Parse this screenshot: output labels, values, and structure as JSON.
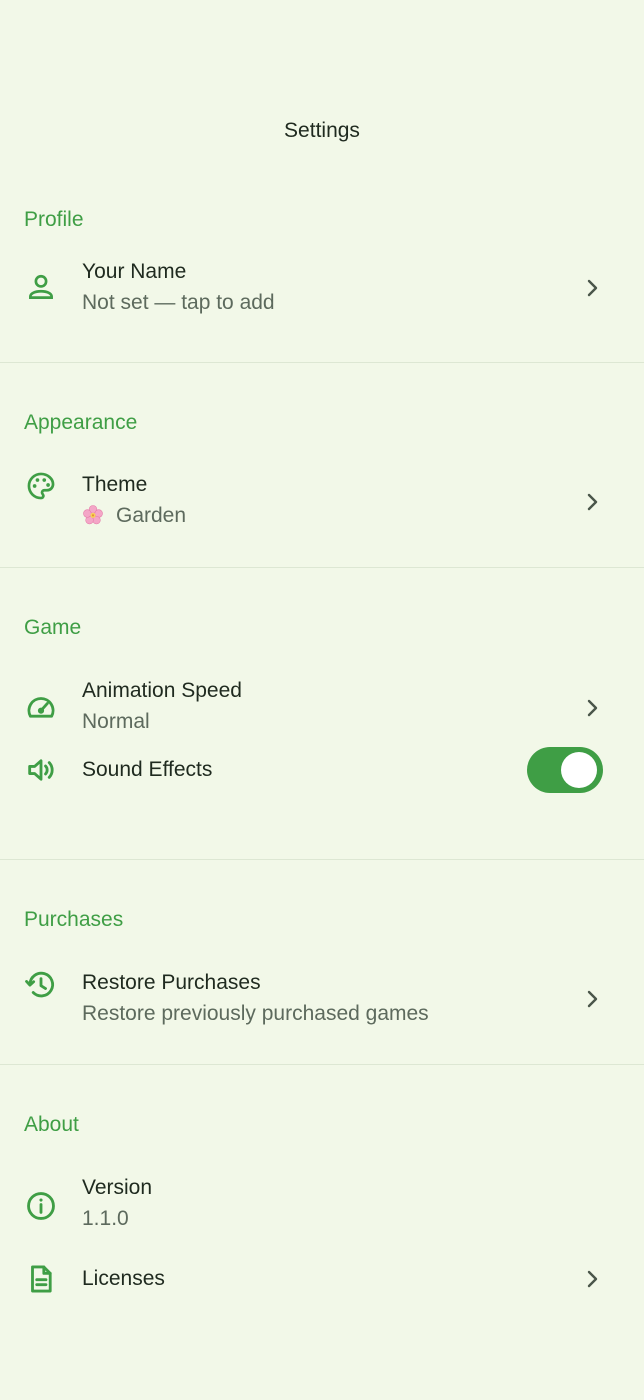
{
  "app_bar": {
    "title": "Settings"
  },
  "sections": {
    "profile": {
      "header": "Profile",
      "your_name": {
        "label": "Your Name",
        "value": "Not set — tap to add",
        "icon": "person-icon"
      }
    },
    "appearance": {
      "header": "Appearance",
      "theme": {
        "label": "Theme",
        "value": "Garden",
        "emoji": "cherry-blossom",
        "icon": "palette-icon"
      }
    },
    "game": {
      "header": "Game",
      "animation_speed": {
        "label": "Animation Speed",
        "value": "Normal",
        "icon": "speedometer-icon"
      },
      "sound_effects": {
        "label": "Sound Effects",
        "enabled": true,
        "icon": "speaker-icon"
      }
    },
    "purchases": {
      "header": "Purchases",
      "restore": {
        "label": "Restore Purchases",
        "value": "Restore previously purchased games",
        "icon": "restore-history-icon"
      }
    },
    "about": {
      "header": "About",
      "version": {
        "label": "Version",
        "value": "1.1.0",
        "icon": "info-icon"
      },
      "licenses": {
        "label": "Licenses",
        "icon": "document-icon"
      }
    }
  },
  "colors": {
    "background": "#f2f8e8",
    "accent": "#3f9e45",
    "divider": "#dde7d3",
    "text_primary": "#1f2a1f",
    "text_secondary": "#5d6a5d"
  }
}
